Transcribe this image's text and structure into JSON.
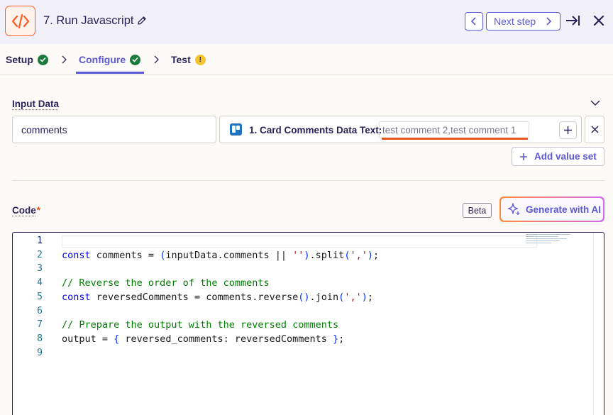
{
  "header": {
    "step_title": "7. Run Javascript",
    "next_step_label": "Next step",
    "icons": {
      "app": "code-icon",
      "edit": "pencil-icon",
      "prev": "chevron-left-icon",
      "next": "chevron-right-icon",
      "expand": "arrow-to-right-icon",
      "close": "close-icon"
    }
  },
  "tabs": [
    {
      "label": "Setup",
      "status": "complete"
    },
    {
      "label": "Configure",
      "status": "complete",
      "active": true
    },
    {
      "label": "Test",
      "status": "warning",
      "badge": "!"
    }
  ],
  "input_data": {
    "label": "Input Data",
    "key": "comments",
    "value_source_label": "1. Card Comments Data Text:",
    "value_preview": "test comment 2,test comment 1",
    "add_value_set_label": "Add value set"
  },
  "code": {
    "label": "Code",
    "required_mark": "*",
    "beta_label": "Beta",
    "generate_ai_label": "Generate with AI",
    "lines": [
      {
        "n": "1",
        "text": ""
      },
      {
        "n": "2",
        "text": "const comments = (inputData.comments || '').split(',');"
      },
      {
        "n": "3",
        "text": ""
      },
      {
        "n": "4",
        "text": "// Reverse the order of the comments"
      },
      {
        "n": "5",
        "text": "const reversedComments = comments.reverse().join(',');"
      },
      {
        "n": "6",
        "text": ""
      },
      {
        "n": "7",
        "text": "// Prepare the output with the reversed comments"
      },
      {
        "n": "8",
        "text": "output = { reversed_comments: reversedComments };"
      },
      {
        "n": "9",
        "text": ""
      }
    ]
  },
  "colors": {
    "accent": "#5d58d6",
    "brand_orange": "#ff5a1f",
    "success": "#1c7a3c",
    "warning": "#f4c531"
  }
}
